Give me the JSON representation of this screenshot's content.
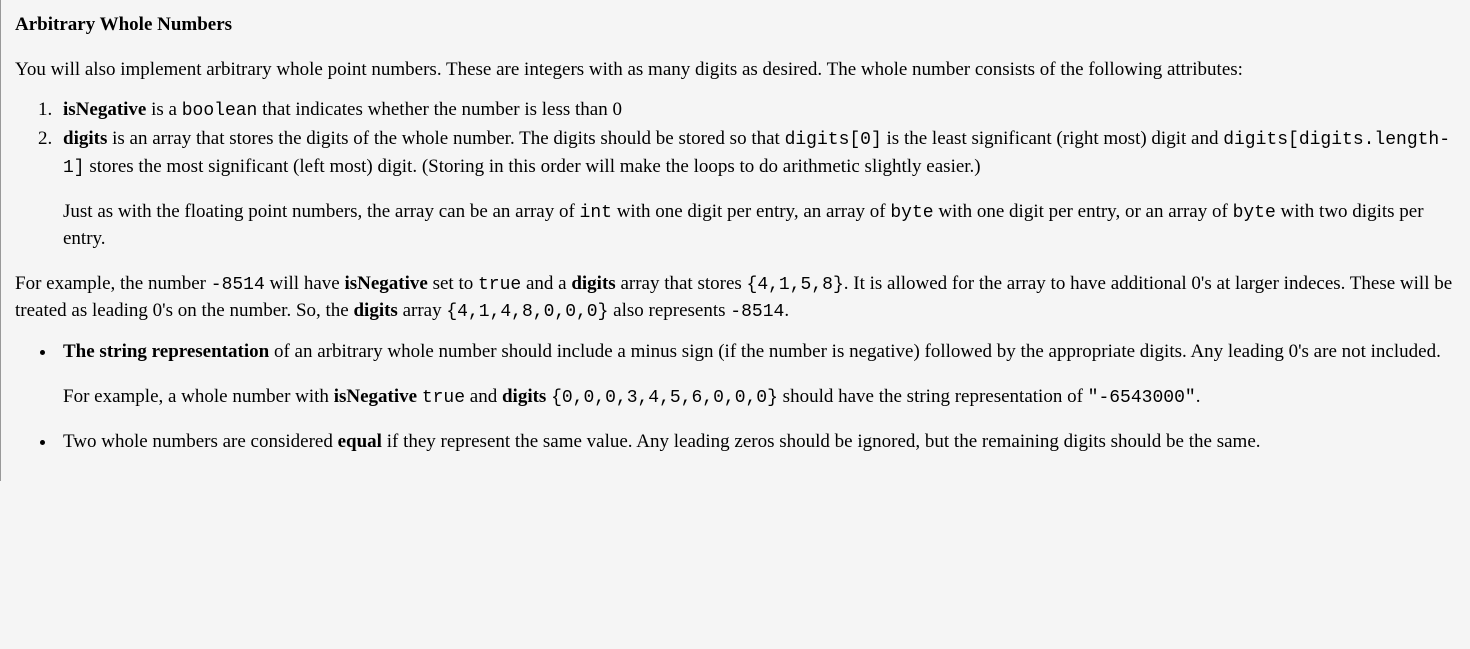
{
  "heading": "Arbitrary Whole Numbers",
  "intro": "You will also implement arbitrary whole point numbers. These are integers with as many digits as desired. The whole number consists of the following attributes:",
  "ol_item1": {
    "bold1": "isNegative",
    "t1": " is a ",
    "code1": "boolean",
    "t2": " that indicates whether the number is less than 0"
  },
  "ol_item2": {
    "bold1": "digits",
    "t1": " is an array that stores the digits of the whole number. The digits should be stored so that ",
    "code1": "digits[0]",
    "t2": " is the least significant (right most) digit and ",
    "code2": "digits[digits.length-1]",
    "t3": " stores the most significant (left most) digit. (Storing in this order will make the loops to do arithmetic slightly easier.)",
    "sub_t1": "Just as with the floating point numbers, the array can be an array of ",
    "sub_code1": "int",
    "sub_t2": " with one digit per entry, an array of ",
    "sub_code2": "byte",
    "sub_t3": " with one digit per entry, or an array of ",
    "sub_code3": "byte",
    "sub_t4": " with two digits per entry."
  },
  "example": {
    "t1": "For example, the number ",
    "code1": "-8514",
    "t2": " will have ",
    "bold1": "isNegative",
    "t3": " set to ",
    "code2": "true",
    "t4": " and a ",
    "bold2": "digits",
    "t5": " array that stores ",
    "code3": "{4,1,5,8}",
    "t6": ". It is allowed for the array to have additional 0's at larger indeces. These will be treated as leading 0's on the number. So, the ",
    "bold3": "digits",
    "t7": " array ",
    "code4": "{4,1,4,8,0,0,0}",
    "t8": " also represents ",
    "code5": "-8514",
    "t9": "."
  },
  "ul_item1": {
    "bold1": "The string representation",
    "t1": " of an arbitrary whole number should include a minus sign (if the number is negative) followed by the appropriate digits. Any leading 0's are not included.",
    "sub_t1": "For example, a whole number with ",
    "sub_bold1": "isNegative",
    "sub_t2": " ",
    "sub_code1": "true",
    "sub_t3": " and ",
    "sub_bold2": "digits",
    "sub_t4": " ",
    "sub_code2": "{0,0,0,3,4,5,6,0,0,0}",
    "sub_t5": " should have the string representation of ",
    "sub_code3": "\"-6543000\"",
    "sub_t6": "."
  },
  "ul_item2": {
    "t1": "Two whole numbers are considered ",
    "bold1": "equal",
    "t2": " if they represent the same value. Any leading zeros should be ignored, but the remaining digits should be the same."
  }
}
